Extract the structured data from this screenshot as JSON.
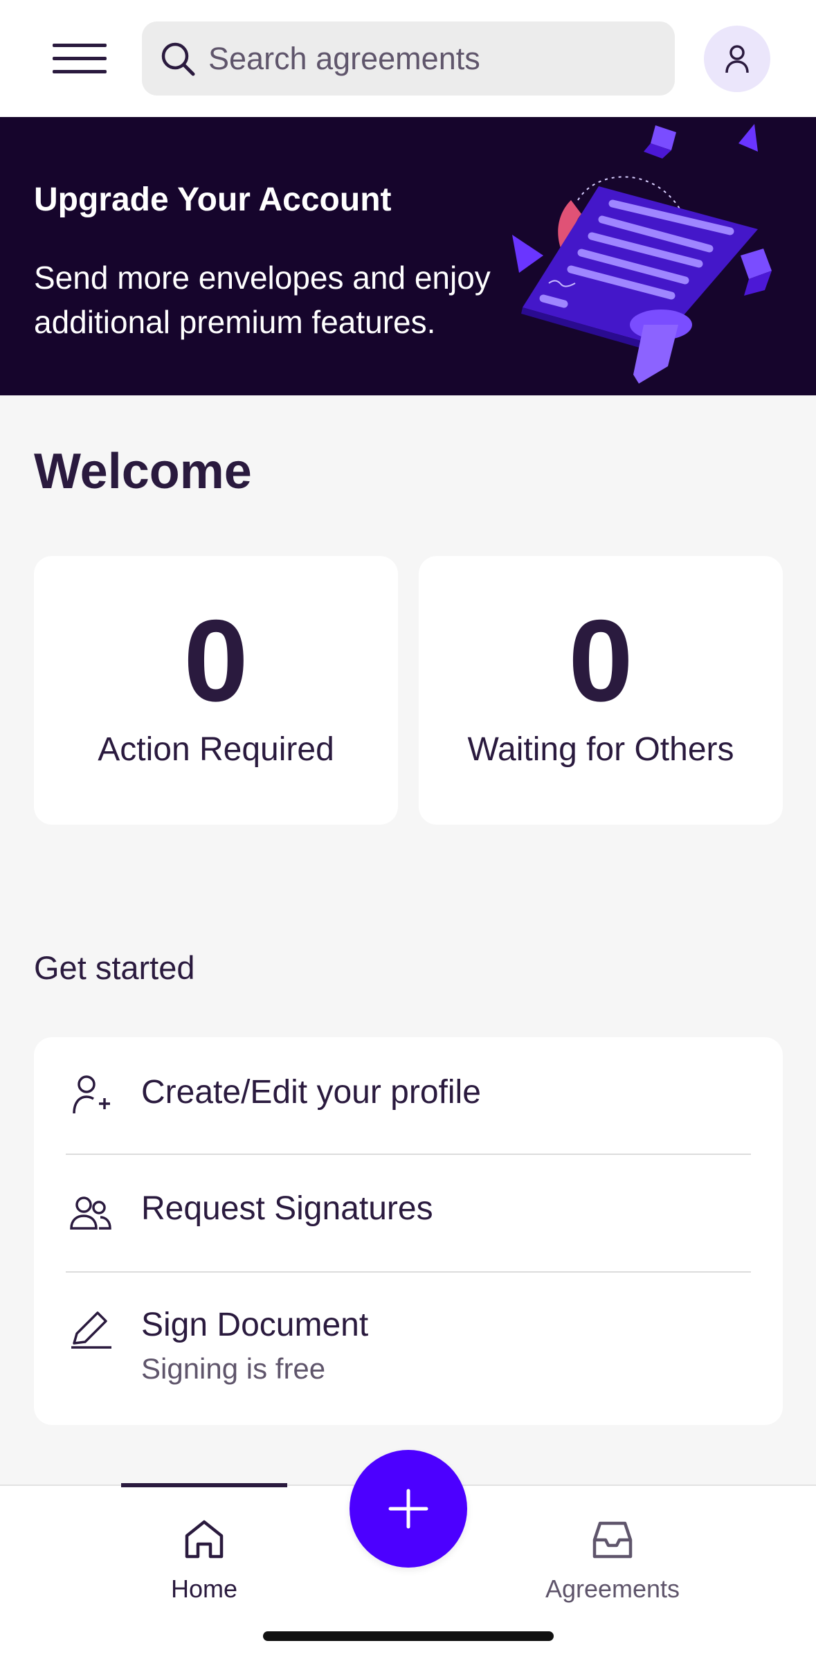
{
  "header": {
    "search_placeholder": "Search agreements",
    "menu_icon": "hamburger-menu-icon",
    "avatar_icon": "person-icon"
  },
  "banner": {
    "title": "Upgrade Your Account",
    "text": "Send more envelopes and enjoy additional premium features.",
    "art": "document-illustration"
  },
  "welcome": {
    "title": "Welcome",
    "stats": [
      {
        "value": "0",
        "label": "Action Required"
      },
      {
        "value": "0",
        "label": "Waiting for Others"
      }
    ]
  },
  "get_started": {
    "title": "Get started",
    "items": [
      {
        "label": "Create/Edit your profile",
        "icon": "person-add-icon"
      },
      {
        "label": "Request Signatures",
        "icon": "people-icon"
      },
      {
        "label": "Sign Document",
        "sublabel": "Signing is free",
        "icon": "pen-icon"
      }
    ]
  },
  "bottom_nav": {
    "home_label": "Home",
    "agreements_label": "Agreements",
    "fab_icon": "plus-icon",
    "active": "Home"
  },
  "colors": {
    "primary": "#4c00ff",
    "text": "#2a1a3e",
    "banner_bg": "#16052c"
  }
}
